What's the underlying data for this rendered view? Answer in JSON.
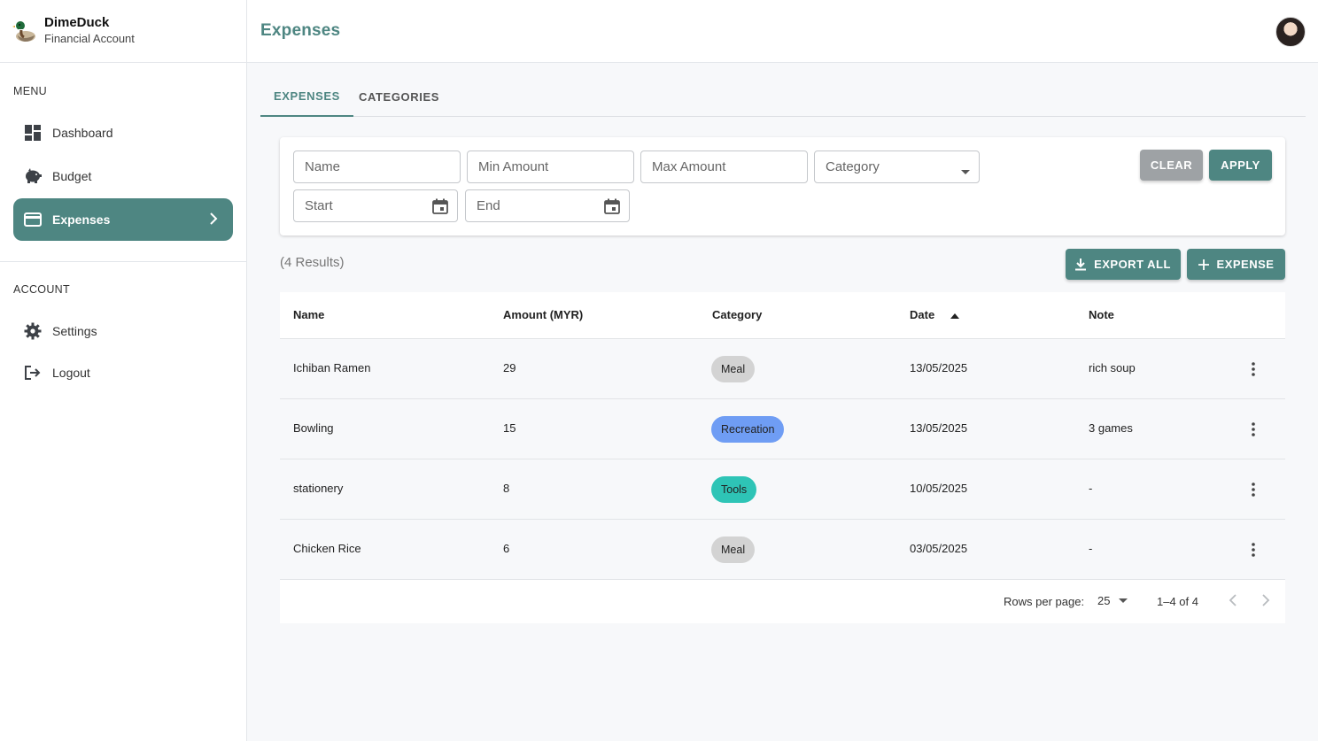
{
  "app": {
    "name": "DimeDuck",
    "subtitle": "Financial Account"
  },
  "sidebar": {
    "menu_label": "MENU",
    "menu_items": [
      {
        "label": "Dashboard",
        "icon": "dashboard-icon"
      },
      {
        "label": "Budget",
        "icon": "piggy-bank-icon"
      },
      {
        "label": "Expenses",
        "icon": "credit-card-icon",
        "active": true
      }
    ],
    "account_label": "ACCOUNT",
    "account_items": [
      {
        "label": "Settings",
        "icon": "gear-icon"
      },
      {
        "label": "Logout",
        "icon": "logout-icon"
      }
    ]
  },
  "header": {
    "title": "Expenses"
  },
  "tabs": [
    {
      "label": "EXPENSES",
      "active": true
    },
    {
      "label": "CATEGORIES",
      "active": false
    }
  ],
  "filters": {
    "name_placeholder": "Name",
    "min_amount_placeholder": "Min Amount",
    "max_amount_placeholder": "Max Amount",
    "category_placeholder": "Category",
    "start_placeholder": "Start",
    "end_placeholder": "End",
    "clear_label": "CLEAR",
    "apply_label": "APPLY"
  },
  "results_text": "(4 Results)",
  "actions": {
    "export_label": "EXPORT ALL",
    "add_label": "EXPENSE"
  },
  "table": {
    "headers": {
      "name": "Name",
      "amount": "Amount (MYR)",
      "category": "Category",
      "date": "Date",
      "note": "Note"
    },
    "sort": {
      "column": "Date",
      "direction": "ascending"
    },
    "rows": [
      {
        "name": "Ichiban Ramen",
        "amount": "29",
        "category": "Meal",
        "date": "13/05/2025",
        "note": "rich soup"
      },
      {
        "name": "Bowling",
        "amount": "15",
        "category": "Recreation",
        "date": "13/05/2025",
        "note": "3 games"
      },
      {
        "name": "stationery",
        "amount": "8",
        "category": "Tools",
        "date": "10/05/2025",
        "note": "-"
      },
      {
        "name": "Chicken Rice",
        "amount": "6",
        "category": "Meal",
        "date": "03/05/2025",
        "note": "-"
      }
    ]
  },
  "category_colors": {
    "Meal": "#d3d3d3",
    "Recreation": "#6f9df4",
    "Tools": "#2ec4b6"
  },
  "pagination": {
    "rows_per_page_label": "Rows per page:",
    "rows_per_page_value": "25",
    "range_text": "1–4 of 4"
  },
  "colors": {
    "accent": "#4e8682",
    "clear_button": "#9ea2a5"
  }
}
